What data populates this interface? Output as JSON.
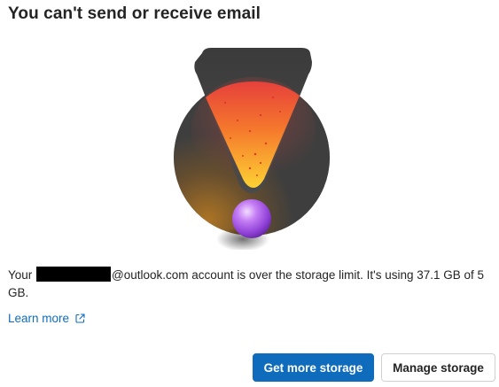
{
  "dialog": {
    "title": "You can't send or receive email",
    "message_prefix": "Your",
    "message_suffix": "@outlook.com account is over the storage limit. It's using 37.1 GB of 5 GB.",
    "learn_more_label": "Learn more",
    "primary_button_label": "Get more storage",
    "secondary_button_label": "Manage storage"
  },
  "colors": {
    "accent": "#0f6cbd",
    "text": "#242424",
    "illustration_dark": "#3d3d3d",
    "illustration_warning_top": "#e8453c",
    "illustration_warning_bottom": "#fcc931",
    "illustration_orb": "#a855e8"
  },
  "icons": {
    "illustration": "warning-exclamation-illustration",
    "learn_more": "open-in-new-window-icon"
  }
}
